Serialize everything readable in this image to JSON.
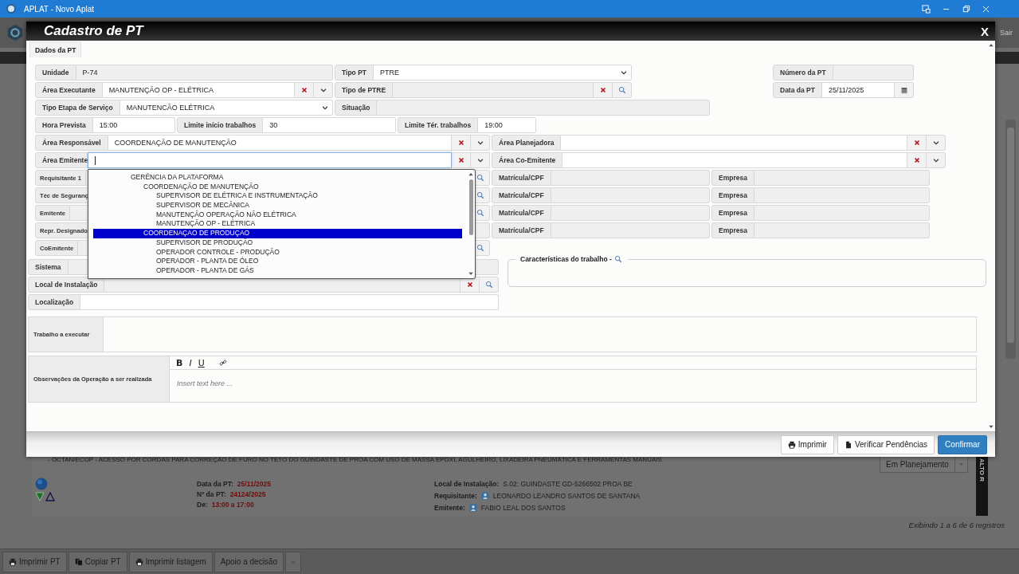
{
  "window": {
    "title": "APLAT - Novo Aplat"
  },
  "header": {
    "logout": "Sair"
  },
  "dialog": {
    "title": "Cadastro de PT",
    "close": "X",
    "tabs": [
      {
        "label": "Dados da PT",
        "selected": true
      }
    ],
    "rows": [
      {
        "fields": [
          {
            "label": "Unidade",
            "kind": "readonly",
            "value": "P-74"
          },
          {
            "label": "Tipo PT",
            "kind": "select",
            "value": "PTRE"
          },
          {
            "label": "Número da PT",
            "kind": "readonly"
          }
        ]
      },
      {
        "fields": [
          {
            "label": "Área Executante",
            "kind": "combo",
            "value": "MANUTENÇÃO OP - ELÉTRICA"
          },
          {
            "label": "Tipo de PTRE",
            "kind": "lookup"
          },
          {
            "label": "Data da PT",
            "kind": "date",
            "value": "25/11/2025"
          }
        ]
      },
      {
        "fields": [
          {
            "label": "Tipo Etapa de Serviço",
            "kind": "select",
            "value": "MANUTENCÃO ELÉTRICA"
          },
          {
            "label": "Situação",
            "kind": "readonly"
          }
        ]
      },
      {
        "fields": [
          {
            "label": "Hora Prevista",
            "kind": "input",
            "value": "15:00"
          },
          {
            "label": "Limite início trabalhos",
            "kind": "input",
            "value": "30"
          },
          {
            "label": "Limite Tér. trabalhos",
            "kind": "input",
            "value": "19:00"
          }
        ]
      },
      {
        "fields": [
          {
            "label": "Área Responsável",
            "kind": "combo",
            "value": "COORDENAÇÃO DE MANUTENÇÃO"
          },
          {
            "label": "Área Planejadora",
            "kind": "combo"
          }
        ]
      },
      {
        "fields": [
          {
            "label": "Área Emitente",
            "kind": "combo",
            "focused": true,
            "dropdown": {
              "items": [
                {
                  "label": "GERÊNCIA DA PLATAFORMA",
                  "selected": false,
                  "children": [
                    {
                      "label": "COORDENAÇÃO DE MANUTENÇÃO",
                      "selected": false,
                      "children": [
                        {
                          "label": "SUPERVISOR DE ELÉTRICA E INSTRUMENTAÇÃO",
                          "selected": false
                        },
                        {
                          "label": "SUPERVISOR DE MECÂNICA",
                          "selected": false
                        },
                        {
                          "label": "MANUTENÇÃO OPERAÇÃO NÃO ELÉTRICA",
                          "selected": false
                        },
                        {
                          "label": "MANUTENÇÃO OP - ELÉTRICA",
                          "selected": false
                        }
                      ]
                    },
                    {
                      "label": "COORDENAÇAO DE PRODUÇAO",
                      "selected": true,
                      "children": [
                        {
                          "label": "SUPERVISOR DE PRODUÇÃO",
                          "selected": false
                        },
                        {
                          "label": "OPERADOR CONTROLE - PRODUÇÃO",
                          "selected": false
                        },
                        {
                          "label": "OPERADOR - PLANTA DE ÓLEO",
                          "selected": false
                        },
                        {
                          "label": "OPERADOR - PLANTA DE GÁS",
                          "selected": false
                        }
                      ]
                    }
                  ]
                }
              ]
            }
          },
          {
            "label": "Área Co-Emitente",
            "kind": "combo"
          }
        ]
      },
      {
        "fields": [
          {
            "label": "Requisitante 1",
            "kind": "search"
          },
          {
            "label": "Matrícula/CPF",
            "kind": "readonly"
          },
          {
            "label": "Empresa",
            "kind": "readonly"
          }
        ]
      },
      {
        "fields": [
          {
            "label": "Téc de Seguranç",
            "kind": "search"
          },
          {
            "label": "Matrícula/CPF",
            "kind": "readonly"
          },
          {
            "label": "Empresa",
            "kind": "readonly"
          }
        ]
      },
      {
        "fields": [
          {
            "label": "Emitente",
            "kind": "search"
          },
          {
            "label": "Matrícula/CPF",
            "kind": "readonly"
          },
          {
            "label": "Empresa",
            "kind": "readonly"
          }
        ]
      },
      {
        "fields": [
          {
            "label": "Repr. Designado",
            "kind": "readonly"
          },
          {
            "label": "Matrícula/CPF",
            "kind": "readonly"
          },
          {
            "label": "Empresa",
            "kind": "readonly"
          }
        ]
      },
      {
        "fields": [
          {
            "label": "CoEmitente",
            "kind": "search"
          }
        ]
      }
    ],
    "side_fields": [
      {
        "label": "Sistema",
        "kind": "readonly"
      },
      {
        "label": "Local de Instalação",
        "kind": "lookup"
      },
      {
        "label": "Localização",
        "kind": "input"
      }
    ],
    "characteristics": {
      "legend": "Características do trabalho -"
    },
    "work": {
      "label": "Trabalho a executar"
    },
    "notes": {
      "label": "Observações da Operação a ser realizada",
      "tools": [
        {
          "label": "B",
          "kind": "bold"
        },
        {
          "label": "I",
          "kind": "italic"
        },
        {
          "label": "U",
          "kind": "underline"
        },
        {
          "kind": "link"
        }
      ],
      "placeholder": "Insert text here ..."
    },
    "buttons": [
      {
        "label": "Imprimir",
        "kind": "print"
      },
      {
        "label": "Verificar Pendências",
        "kind": "file"
      },
      {
        "label": "Confirmar",
        "kind": "primary"
      }
    ]
  },
  "record": {
    "description": "- OCTAN/ECOP - ACESSO POR CORDAS PARA CORREÇÃO DE FURO NO TETO DO GUINDASTE DE PROA COM USO DE MASSA EPOXI, AGULHEIRO, LIXADEIRA PNEUMÁTICA E FERRAMENTAS MANUAIS",
    "status": "Em Planejamento",
    "risk": "ALTO R",
    "dates": [
      {
        "label": "Data da PT:",
        "value": "25/11/2025"
      },
      {
        "label": "Nº da PT:",
        "value": "24124/2025"
      },
      {
        "label": "De:",
        "value": "13:00 a 17:00"
      }
    ],
    "details": [
      {
        "label": "Local de Instalação:",
        "value": "S.02: GUINDASTE GD-5266502 PROA BE",
        "person": false
      },
      {
        "label": "Requisitante:",
        "value": "LEONARDO LEANDRO SANTOS DE SANTANA",
        "person": true
      },
      {
        "label": "Emitente:",
        "value": "FABIO LEAL DOS SANTOS",
        "person": true
      }
    ]
  },
  "summary": "Exibindo 1 a 6 de 6 registros",
  "toolbar": [
    {
      "label": "Imprimir PT",
      "kind": "print"
    },
    {
      "label": "Copiar PT",
      "kind": "copy"
    },
    {
      "label": "Imprimir listagem",
      "kind": "print"
    },
    {
      "label": "Apoio a decisão",
      "kind": "plain"
    }
  ]
}
